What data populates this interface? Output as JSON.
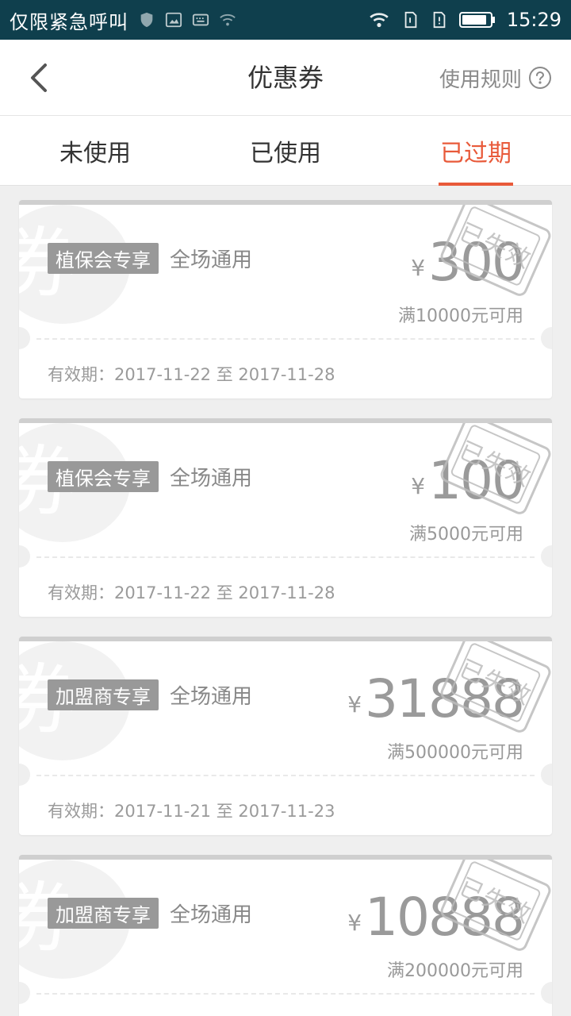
{
  "status_bar": {
    "left_text": "仅限紧急呼叫",
    "time": "15:29"
  },
  "header": {
    "title": "优惠券",
    "rules_label": "使用规则"
  },
  "tabs": [
    {
      "label": "未使用",
      "active": false
    },
    {
      "label": "已使用",
      "active": false
    },
    {
      "label": "已过期",
      "active": true
    }
  ],
  "coupons": [
    {
      "bg_char": "券",
      "tag": "植保会专享",
      "scope": "全场通用",
      "currency": "¥",
      "amount": "300",
      "condition": "满10000元可用",
      "validity": "有效期：2017-11-22 至 2017-11-28",
      "stamp": "已失效"
    },
    {
      "bg_char": "券",
      "tag": "植保会专享",
      "scope": "全场通用",
      "currency": "¥",
      "amount": "100",
      "condition": "满5000元可用",
      "validity": "有效期：2017-11-22 至 2017-11-28",
      "stamp": "已失效"
    },
    {
      "bg_char": "券",
      "tag": "加盟商专享",
      "scope": "全场通用",
      "currency": "¥",
      "amount": "31888",
      "condition": "满500000元可用",
      "validity": "有效期：2017-11-21 至 2017-11-23",
      "stamp": "已失效"
    },
    {
      "bg_char": "券",
      "tag": "加盟商专享",
      "scope": "全场通用",
      "currency": "¥",
      "amount": "10888",
      "condition": "满200000元可用",
      "validity": "",
      "stamp": "已失效"
    }
  ],
  "colors": {
    "status_bar": "#0f3f4d",
    "accent": "#e85a3a",
    "muted_text": "#999999",
    "page_bg": "#efefef"
  },
  "icons": [
    "back-arrow-icon",
    "help-circle-icon",
    "wifi-icon",
    "battery-icon",
    "shield-icon",
    "image-icon",
    "keyboard-icon",
    "sim-icon"
  ]
}
